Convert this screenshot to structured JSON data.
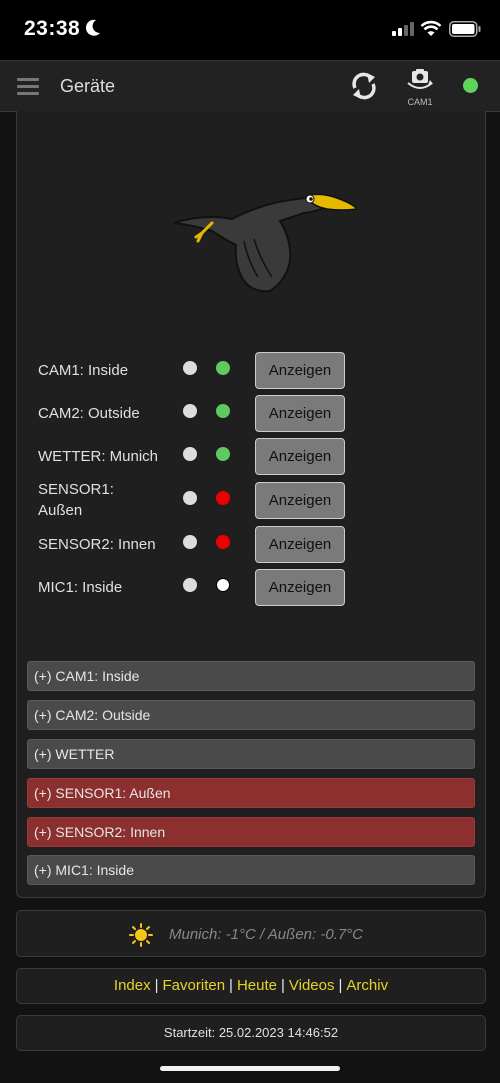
{
  "status_bar": {
    "time": "23:38"
  },
  "header": {
    "title": "Geräte",
    "camera_label": "CAM1",
    "status_color": "#5dd55d"
  },
  "devices": [
    {
      "name": "CAM1: Inside",
      "status": "green",
      "button": "Anzeigen"
    },
    {
      "name": "CAM2: Outside",
      "status": "green",
      "button": "Anzeigen"
    },
    {
      "name": "WETTER: Munich",
      "status": "green",
      "button": "Anzeigen"
    },
    {
      "name": "SENSOR1: Außen",
      "status": "red",
      "button": "Anzeigen"
    },
    {
      "name": "SENSOR2: Innen",
      "status": "red",
      "button": "Anzeigen"
    },
    {
      "name": "MIC1: Inside",
      "status": "none",
      "button": "Anzeigen"
    }
  ],
  "accordion": [
    {
      "label": "(+) CAM1: Inside",
      "alert": false
    },
    {
      "label": "(+) CAM2: Outside",
      "alert": false
    },
    {
      "label": "(+) WETTER",
      "alert": false
    },
    {
      "label": "(+) SENSOR1: Außen",
      "alert": true
    },
    {
      "label": "(+) SENSOR2: Innen",
      "alert": true
    },
    {
      "label": "(+) MIC1: Inside",
      "alert": false
    }
  ],
  "weather": {
    "text": "Munich: -1°C / Außen: -0.7°C"
  },
  "links": [
    "Index",
    "Favoriten",
    "Heute",
    "Videos",
    "Archiv"
  ],
  "footer": {
    "start_time": "Startzeit: 25.02.2023 14:46:52"
  },
  "colors": {
    "accent_link": "#e8d22a",
    "alert_red": "#8b2f2f",
    "ok_green": "#5ec95e",
    "error_red": "#e00000"
  }
}
